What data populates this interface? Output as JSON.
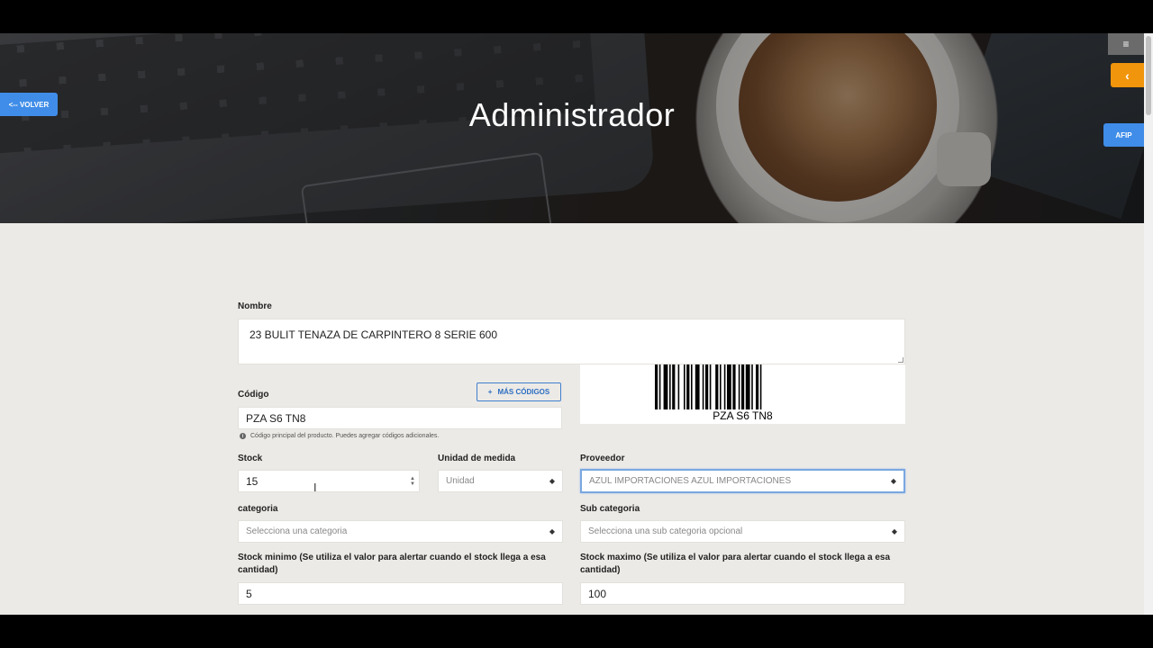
{
  "hero": {
    "title": "Administrador"
  },
  "nav": {
    "volver_label": "<-- VOLVER",
    "menu_icon": "hamburger-icon",
    "menu_glyph": "≡",
    "back_icon": "chevron-left-icon",
    "back_glyph": "‹",
    "afip_label": "AFIP"
  },
  "form": {
    "nombre": {
      "label": "Nombre",
      "value": "23 BULIT TENAZA DE CARPINTERO 8 SERIE 600"
    },
    "codigo": {
      "label": "Código",
      "value": "PZA S6 TN8",
      "add_button_label": "MÁS CÓDIGOS",
      "add_button_glyph": "+",
      "hint": "Código principal del producto. Puedes agregar códigos adicionales.",
      "barcode_text": "PZA S6 TN8"
    },
    "stock": {
      "label": "Stock",
      "value": "15"
    },
    "unidad": {
      "label": "Unidad de medida",
      "selected": "Unidad"
    },
    "proveedor": {
      "label": "Proveedor",
      "selected": "AZUL IMPORTACIONES AZUL IMPORTACIONES"
    },
    "categoria": {
      "label": "categoria",
      "placeholder": "Selecciona una categoria"
    },
    "subcategoria": {
      "label": "Sub categoria",
      "placeholder": "Selecciona una sub categoria opcional"
    },
    "stock_minimo": {
      "label": "Stock minimo (Se utiliza el valor para alertar cuando el stock llega a esa cantidad)",
      "value": "5"
    },
    "stock_maximo": {
      "label": "Stock maximo (Se utiliza el valor para alertar cuando el stock llega a esa cantidad)",
      "value": "100"
    }
  },
  "colors": {
    "primary": "#3f8de8",
    "accent": "#f0950c",
    "background": "#eceae6"
  }
}
